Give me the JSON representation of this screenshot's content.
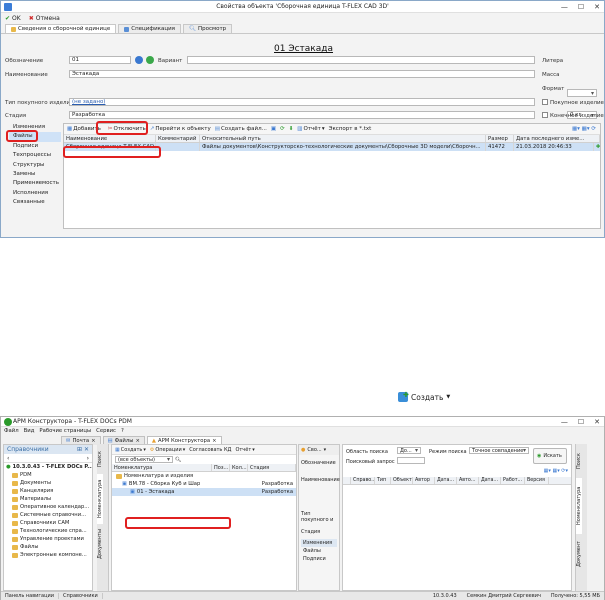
{
  "dialog": {
    "title": "Свойства объекта 'Сборочная единица T-FLEX CAD 3D'",
    "controls": [
      "—",
      "☐",
      "✕"
    ],
    "ok_label": "OK",
    "cancel_label": "Отмена",
    "tabs": [
      {
        "label": "Сведения о сборочной единице",
        "color": "#e8b84a"
      },
      {
        "label": "Спецификация",
        "color": "#5a8fd6"
      },
      {
        "label": "Просмотр",
        "color": "#5a8fd6"
      }
    ],
    "object_title": "01 Эстакада",
    "fields": {
      "designation_label": "Обозначение",
      "designation_value": "01",
      "variant_label": "Вариант",
      "name_label": "Наименование",
      "name_value": "Эстакада",
      "litera_label": "Литера",
      "mass_label": "Масса",
      "mass_value": "0",
      "mass_unit": "0 кг",
      "format_label": "Формат",
      "purchased_type_label": "Тип покупного изделия",
      "purchased_type_value": "(не задано)",
      "stage_label": "Стадия",
      "stage_value": "Разработка",
      "purchased_chk_label": "Покупное изделие",
      "final_chk_label": "Конечное изделие"
    },
    "nav": [
      "Изменения",
      "Файлы",
      "Подписи",
      "Техпроцессы",
      "Структуры",
      "Замены",
      "Применяемость",
      "Исполнения",
      "Связанные"
    ],
    "nav_selected": 1,
    "files_toolbar": {
      "add": "Добавить",
      "detach": "Отключить",
      "goto": "Перейти к объекту",
      "create_file": "Создать файл...",
      "report": "Отчёт",
      "export": "Экспорт в *.txt"
    },
    "grid_headers": [
      "Наименование",
      "Комментарий",
      "Относительный путь",
      "Размер",
      "Дата последнего изме..."
    ],
    "grid_row": {
      "name": "Сборочная единица T-FLEX CAD 3D.grb",
      "comment": "",
      "path": "Файлы документов\\Конструкторско-технологические документы\\Сборочные 3D модели\\Сборочн...",
      "size": "41472",
      "date": "21.03.2018 20:46:33"
    }
  },
  "create_button": {
    "label": "Создать",
    "arrow": "▼"
  },
  "main_window": {
    "title": "АРМ Конструктора - T-FLEX DOCs PDM",
    "controls": [
      "—",
      "☐",
      "✕"
    ],
    "menu": [
      "Файл",
      "Вид",
      "Рабочие страницы",
      "Сервис",
      "?"
    ],
    "doc_tabs": [
      "Почта",
      "Файлы",
      "АРМ Конструктора"
    ],
    "doc_tab_active": 2,
    "ref_panel_title": "Справочники",
    "ref_tree": [
      "10.3.0.43 - T-FLEX DOCs P...",
      "PDM",
      "Документы",
      "Канцелярия",
      "Материалы",
      "Оперативное календар...",
      "Системные справочни...",
      "Справочники САМ",
      "Технологические спра...",
      "Управление проектами",
      "Файлы",
      "Электронные компоне..."
    ],
    "vtabs_left": [
      "Поиск",
      "Номенклатура",
      "Документы"
    ],
    "center_toolbar": {
      "create": "Создать",
      "ops": "Операции",
      "agree": "Согласовать КД",
      "report": "Отчёт"
    },
    "search_combo": "(все объекты)",
    "nomen_headers": [
      "Номенклатура",
      "Поз...",
      "Кол...",
      "Стадия"
    ],
    "nomen_tree": [
      {
        "label": "Номенклатура и изделия",
        "stage": ""
      },
      {
        "label": "ВМ.78 - Сборка Куб и Шар",
        "stage": "Разработка"
      },
      {
        "label": "01 - Эстакада",
        "stage": "Разработка"
      }
    ],
    "props_tab": "Сво...",
    "props_labels": [
      "Обозначение",
      "Наименование",
      "Тип покупного и",
      "Стадия"
    ],
    "props_nav": [
      "Изменения",
      "Файлы",
      "Подписи"
    ],
    "search": {
      "area_label": "Область поиска",
      "area_value": "До...",
      "mode_label": "Режим поиска",
      "mode_value": "Точное совпадение",
      "query_label": "Поисковый запрос",
      "find_label": "Искать",
      "result_headers": [
        "Справо...",
        "Тип",
        "Объект",
        "Автор",
        "Дата...",
        "Авто...",
        "Дата...",
        "Работ...",
        "Версия"
      ]
    },
    "vtabs_right": [
      "Поиск",
      "Номенклатура",
      "Документ"
    ],
    "status": {
      "left_tabs": [
        "Панель навигации",
        "Справочники"
      ],
      "version": "10.3.0.43",
      "user": "Семкин Дмитрий Сергеевич",
      "received": "Получено: 5,55 МБ"
    }
  }
}
